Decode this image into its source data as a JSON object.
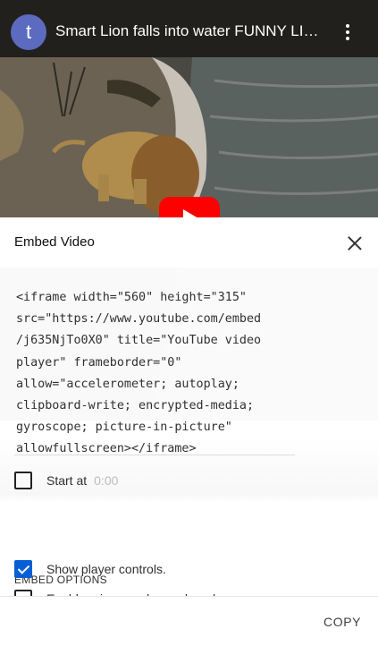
{
  "video": {
    "channel_initial": "t",
    "title": "Smart Lion falls into water FUNNY LION VIDEO"
  },
  "dialog": {
    "title": "Embed Video",
    "embed_code": "<iframe width=\"560\" height=\"315\"\nsrc=\"https://www.youtube.com/embed\n/j635NjTo0X0\" title=\"YouTube video\nplayer\" frameborder=\"0\"\nallow=\"accelerometer; autoplay;\nclipboard-write; encrypted-media;\ngyroscope; picture-in-picture\"\nallowfullscreen></iframe>",
    "start_at_label": "Start at",
    "start_at_value": "0:00",
    "start_at_checked": false,
    "section_title": "EMBED OPTIONS",
    "options": [
      {
        "label": "Show player controls.",
        "checked": true
      },
      {
        "label": "Enable privacy-enhanced mode.",
        "checked": false
      }
    ],
    "copy_label": "COPY"
  },
  "colors": {
    "accent": "#065fd4",
    "play_button": "#ff0000",
    "avatar": "#5c6bc0"
  }
}
